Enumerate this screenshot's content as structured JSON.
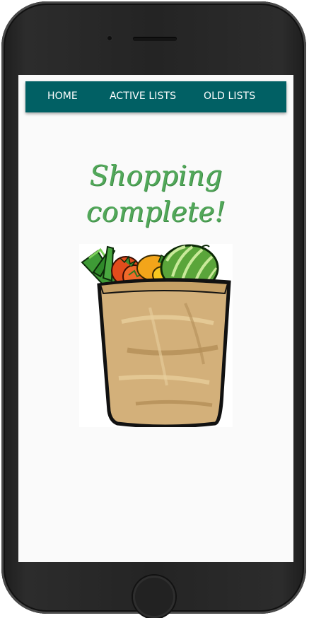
{
  "nav": {
    "items": [
      {
        "label": "HOME"
      },
      {
        "label": "ACTIVE LISTS"
      },
      {
        "label": "OLD LISTS"
      }
    ]
  },
  "main": {
    "title_line1": "Shopping",
    "title_line2": "complete!",
    "image": "grocery-bag-illustration"
  },
  "colors": {
    "navbar": "#016064",
    "title": "#52a85a",
    "bag": "#d3b07a"
  }
}
